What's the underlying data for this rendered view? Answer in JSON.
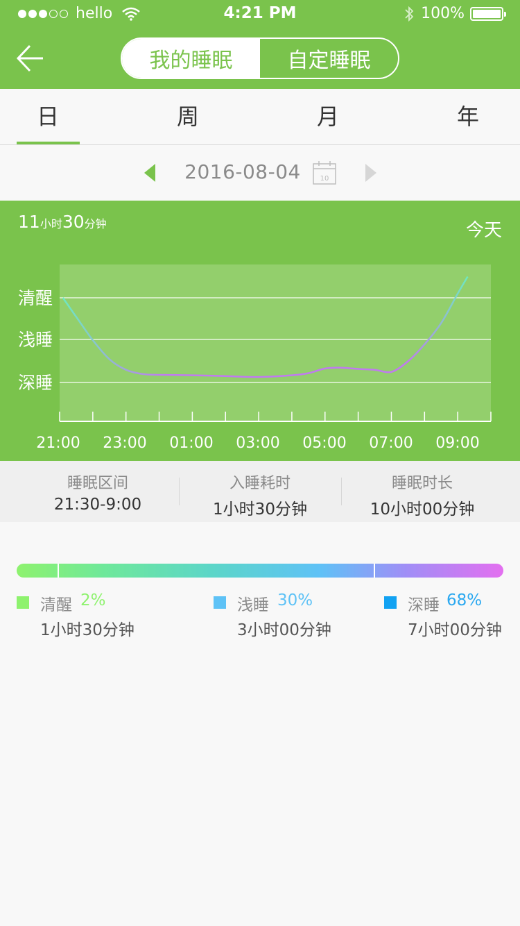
{
  "status_bar": {
    "carrier": "hello",
    "time": "4:21 PM",
    "battery": "100%"
  },
  "header": {
    "segments": [
      "我的睡眠",
      "自定睡眠"
    ],
    "active_segment": 0
  },
  "tabs": [
    "日",
    "周",
    "月",
    "年"
  ],
  "active_tab": 0,
  "date_nav": {
    "date": "2016-08-04",
    "calendar_day": "10"
  },
  "summary": {
    "hours": "11",
    "hours_unit": "小时",
    "minutes": "30",
    "minutes_unit": "分钟",
    "today_label": "今天"
  },
  "chart_data": {
    "type": "line",
    "y_levels": [
      "清醒",
      "浅睡",
      "深睡"
    ],
    "x_tick_labels": [
      "21:00",
      "23:00",
      "01:00",
      "03:00",
      "05:00",
      "07:00",
      "09:00"
    ],
    "x_hours": [
      21.1,
      21.5,
      22.0,
      22.5,
      23.0,
      23.5,
      24.0,
      25.0,
      26.0,
      27.0,
      28.0,
      28.5,
      29.0,
      29.5,
      30.0,
      30.5,
      31.0,
      31.5,
      32.0,
      32.5,
      33.0,
      33.3
    ],
    "y_values": [
      2.0,
      1.55,
      1.0,
      0.55,
      0.3,
      0.2,
      0.18,
      0.17,
      0.15,
      0.13,
      0.17,
      0.22,
      0.33,
      0.35,
      0.32,
      0.3,
      0.25,
      0.5,
      0.9,
      1.4,
      2.1,
      2.5
    ],
    "grid": true
  },
  "stats": [
    {
      "label": "睡眠区间",
      "value": "21:30-9:00"
    },
    {
      "label": "入睡耗时",
      "value": "1小时30分钟"
    },
    {
      "label": "睡眠时长",
      "value": "10小时00分钟"
    }
  ],
  "distribution": [
    {
      "name": "清醒",
      "percent": "2%",
      "duration": "1小时30分钟",
      "color": "#8ef26e"
    },
    {
      "name": "浅睡",
      "percent": "30%",
      "duration": "3小时00分钟",
      "color": "#5ec2f6"
    },
    {
      "name": "深睡",
      "percent": "68%",
      "duration": "7小时00分钟",
      "color": "#12a2f2"
    }
  ],
  "colors": {
    "accent": "#7ac34c",
    "chart_line_start": "#6ee8c0",
    "chart_line_end": "#c07af0"
  }
}
